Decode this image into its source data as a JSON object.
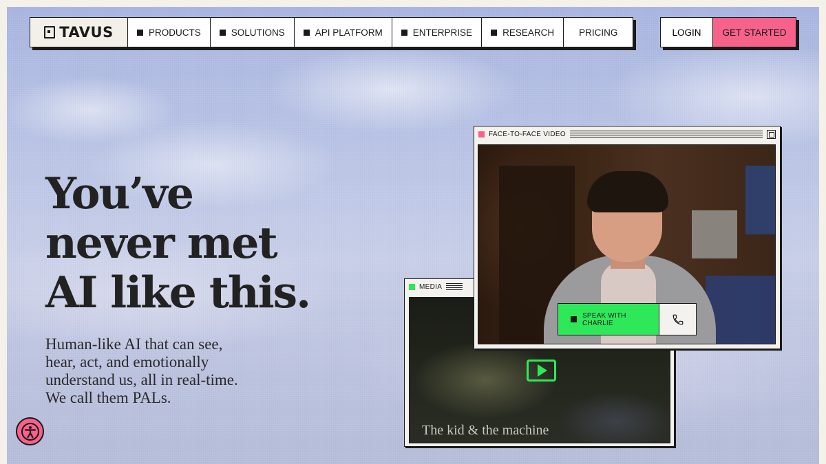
{
  "brand": {
    "name": "TAVUS"
  },
  "nav": {
    "items": [
      {
        "label": "PRODUCTS",
        "bullet": true
      },
      {
        "label": "SOLUTIONS",
        "bullet": true
      },
      {
        "label": "API PLATFORM",
        "bullet": true
      },
      {
        "label": "ENTERPRISE",
        "bullet": true
      },
      {
        "label": "RESEARCH",
        "bullet": true
      },
      {
        "label": "PRICING",
        "bullet": false
      }
    ],
    "login_label": "LOGIN",
    "cta_label": "GET STARTED"
  },
  "hero": {
    "headline_lines": [
      "You’ve",
      "never met",
      "AI like this."
    ],
    "subtext": "Human-like AI that can see, hear, act, and emotionally understand us, all in real-time. We call them PALs."
  },
  "video_window": {
    "title": "FACE-TO-FACE VIDEO",
    "speak_label": "SPEAK WITH CHARLIE",
    "call_icon": "phone-icon"
  },
  "media_window": {
    "title": "MEDIA",
    "caption": "The kid & the machine",
    "play_icon": "play-icon"
  },
  "colors": {
    "accent_pink": "#f7628a",
    "accent_green": "#2fe85a",
    "ink": "#1a1a1a"
  }
}
